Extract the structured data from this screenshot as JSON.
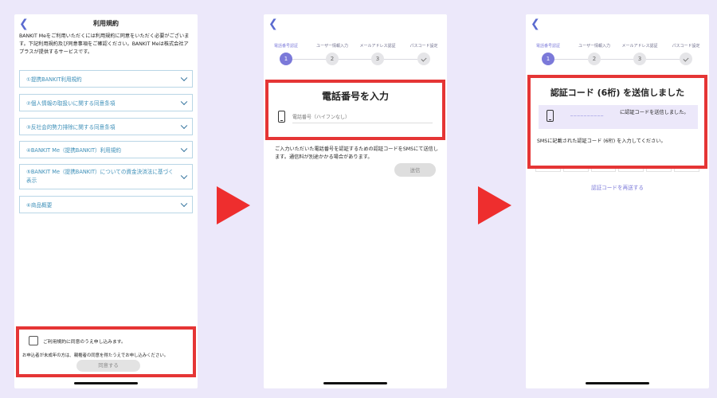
{
  "screen1": {
    "title": "利用規約",
    "intro": "BANKIT Meをご利用いただくには利用規約に同意をいただく必要がございます。下記利用規約及び同意事項をご確認ください。BANKIT Meは株式会社アプラスが提供するサービスです。",
    "terms": [
      {
        "label": "①提携BANKIT利用規約"
      },
      {
        "label": "②個人情報の取扱いに関する同意条項"
      },
      {
        "label": "③反社会的勢力排除に関する同意条項"
      },
      {
        "label": "④BANKIT Me（提携BANKIT）利用規約"
      },
      {
        "label": "⑤BANKIT Me（提携BANKIT）についての資金決済法に基づく表示"
      },
      {
        "label": "⑥商品概要"
      }
    ],
    "consent_label": "ご利用規約に同意のうえ申し込みます。",
    "minor_note": "お申込者が未成年の方は、親権者の同意を得たうえでお申し込みください。",
    "agree_button": "同意する"
  },
  "steps": {
    "labels": [
      "電話番号認証",
      "ユーザー情報入力",
      "メールアドレス認証",
      "パスコード設定"
    ],
    "numbers": [
      "1",
      "2",
      "3"
    ]
  },
  "screen2": {
    "heading": "電話番号を入力",
    "phone_placeholder": "電話番号（ハイフンなし）",
    "description": "ご入力いただいた電話番号を認証するための認証コードをSMSにて送信します。通信料が別途かかる場合があります。",
    "send_button": "送信"
  },
  "screen3": {
    "heading": "認証コード (6桁) を送信しました",
    "masked_number": "_ _ _ _ _ _ _ _ _ _",
    "sent_text": "に認証コードを送信しました。",
    "sms_note": "SMSに記載された認証コード (6桁) を入力してください。",
    "resend": "認証コードを再送する"
  },
  "colors": {
    "accent": "#7b79d9",
    "highlight": "#e53535",
    "link": "#3d8fb8",
    "background": "#ece8fa"
  }
}
